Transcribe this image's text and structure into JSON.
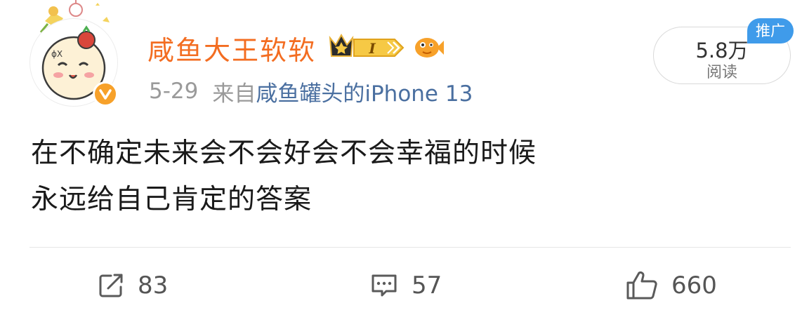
{
  "user": {
    "name": "咸鱼大王软软",
    "vip_level": "I"
  },
  "meta": {
    "date": "5-29",
    "from_label": "来自",
    "source": "咸鱼罐头的iPhone 13"
  },
  "stats_pill": {
    "count": "5.8万",
    "label": "阅读",
    "promo_tag": "推广"
  },
  "content": {
    "lines": [
      "在不确定未来会不会好会不会幸福的时候",
      "永远给自己肯定的答案"
    ]
  },
  "actions": {
    "repost_count": "83",
    "comment_count": "57",
    "like_count": "660"
  },
  "colors": {
    "username": "#f36d21",
    "source_link": "#4a6fa0",
    "promo_tag": "#3f9bea",
    "verified": "#f7a12a"
  }
}
